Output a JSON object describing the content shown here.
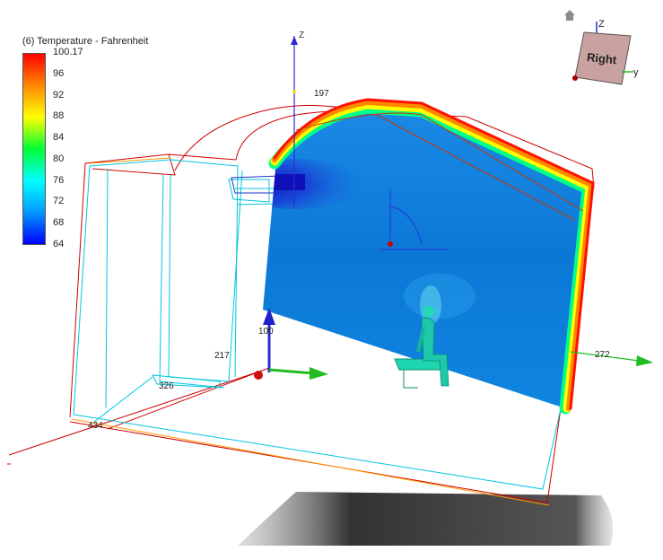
{
  "legend": {
    "title": "(6) Temperature - Fahrenheit",
    "min": 64,
    "max": 100.17,
    "ticks": [
      "100.17",
      "96",
      "92",
      "88",
      "84",
      "80",
      "76",
      "72",
      "68",
      "64"
    ],
    "gradient_colors": [
      "#ff0000",
      "#ff8800",
      "#ffff00",
      "#00ff33",
      "#00ffff",
      "#0099ff",
      "#0000ff"
    ]
  },
  "viewcube": {
    "face_label": "Right",
    "axis_z": "Z",
    "axis_y": "y",
    "face_color": "#c9a1a1"
  },
  "scene": {
    "axis_label_z": "Z",
    "dim_197": "197",
    "dim_100": "100",
    "dim_217": "217",
    "dim_326": "326",
    "dim_434": "434",
    "dim_272": "272"
  },
  "colors": {
    "plane_base": "#0a7fe0",
    "outline_red": "#cc0000",
    "outline_cyan": "#00c6e0",
    "outline_orange": "#ff9900",
    "axis_blue": "#2b2bd0",
    "axis_green": "#22bb22"
  }
}
